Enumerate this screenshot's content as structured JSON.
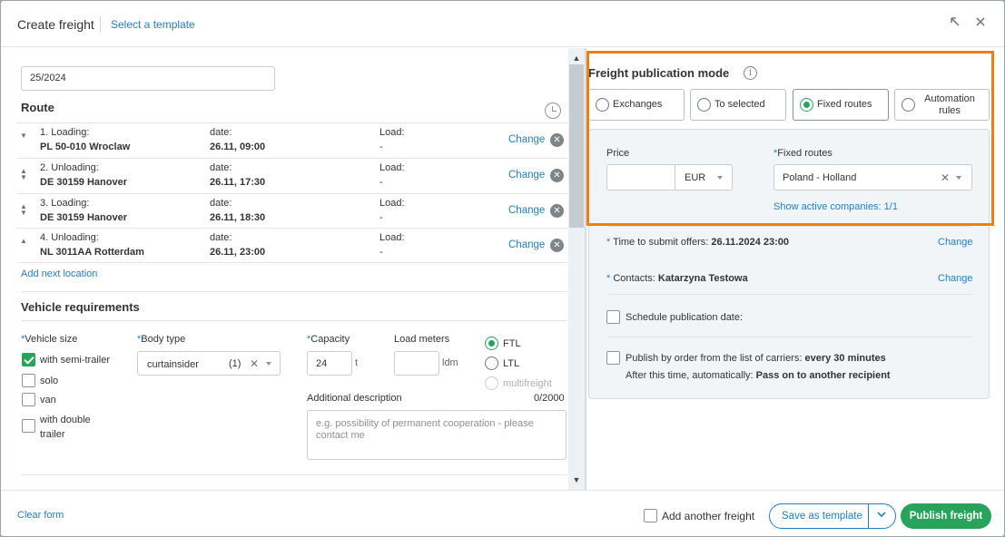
{
  "header": {
    "title": "Create freight",
    "template_link": "Select a template",
    "icons": [
      "collapse-icon",
      "close-icon"
    ]
  },
  "form": {
    "reference_value": "25/2024",
    "route_title": "Route",
    "route_stops": [
      {
        "label": "1. Loading:",
        "place": "PL 50-010 Wroclaw",
        "date_label": "date:",
        "date": "26.11, 09:00",
        "load_label": "Load:",
        "load": "-",
        "change": "Change"
      },
      {
        "label": "2. Unloading:",
        "place": "DE 30159 Hanover",
        "date_label": "date:",
        "date": "26.11, 17:30",
        "load_label": "Load:",
        "load": "-",
        "change": "Change"
      },
      {
        "label": "3. Loading:",
        "place": "DE 30159 Hanover",
        "date_label": "date:",
        "date": "26.11, 18:30",
        "load_label": "Load:",
        "load": "-",
        "change": "Change"
      },
      {
        "label": "4. Unloading:",
        "place": "NL 3011AA Rotterdam",
        "date_label": "date:",
        "date": "26.11, 23:00",
        "load_label": "Load:",
        "load": "-",
        "change": "Change"
      }
    ],
    "add_location": "Add next location",
    "vehicle_title": "Vehicle requirements",
    "vehicle_size_label": "Vehicle size",
    "vehicle_sizes": [
      {
        "label": "with semi-trailer",
        "checked": true
      },
      {
        "label": "solo",
        "checked": false
      },
      {
        "label": "van",
        "checked": false
      },
      {
        "label": "with double trailer",
        "checked": false
      }
    ],
    "body_type_label": "Body type",
    "body_type_value": "curtainsider",
    "body_type_count": "(1)",
    "capacity_label": "Capacity",
    "capacity_value": "24",
    "capacity_unit": "t",
    "load_meters_label": "Load meters",
    "load_meters_unit": "ldm",
    "load_type_options": [
      {
        "label": "FTL",
        "selected": true,
        "disabled": false
      },
      {
        "label": "LTL",
        "selected": false,
        "disabled": false
      },
      {
        "label": "multifreight",
        "selected": false,
        "disabled": true
      }
    ],
    "additional_desc_label": "Additional description",
    "additional_desc_counter": "0/2000",
    "additional_desc_placeholder": "e.g. possibility of permanent cooperation - please contact me"
  },
  "publication": {
    "title": "Freight publication mode",
    "modes": [
      {
        "label": "Exchanges",
        "selected": false
      },
      {
        "label": "To selected",
        "selected": false
      },
      {
        "label": "Fixed routes",
        "selected": true
      },
      {
        "label": "Automation rules",
        "selected": false
      }
    ],
    "price_label": "Price",
    "price_value": "",
    "currency": "EUR",
    "fixed_routes_label": "Fixed routes",
    "fixed_routes_value": "Poland - Holland",
    "show_active": "Show active companies: 1/1",
    "time_label": "Time to submit offers:",
    "time_value": "26.11.2024 23:00",
    "contacts_label": "Contacts:",
    "contacts_value": "Katarzyna Testowa",
    "change": "Change",
    "schedule_label": "Schedule publication date:",
    "publish_order_label": "Publish by order from the list of carriers:",
    "publish_order_value": "every 30 minutes",
    "after_label": "After this time, automatically:",
    "after_value": "Pass on to another recipient"
  },
  "footer": {
    "clear_form": "Clear form",
    "add_another": "Add another freight",
    "save_template": "Save as template",
    "publish": "Publish freight"
  },
  "colors": {
    "accent": "#1f7fc4",
    "green": "#27a35a",
    "highlight": "#f07f10"
  }
}
